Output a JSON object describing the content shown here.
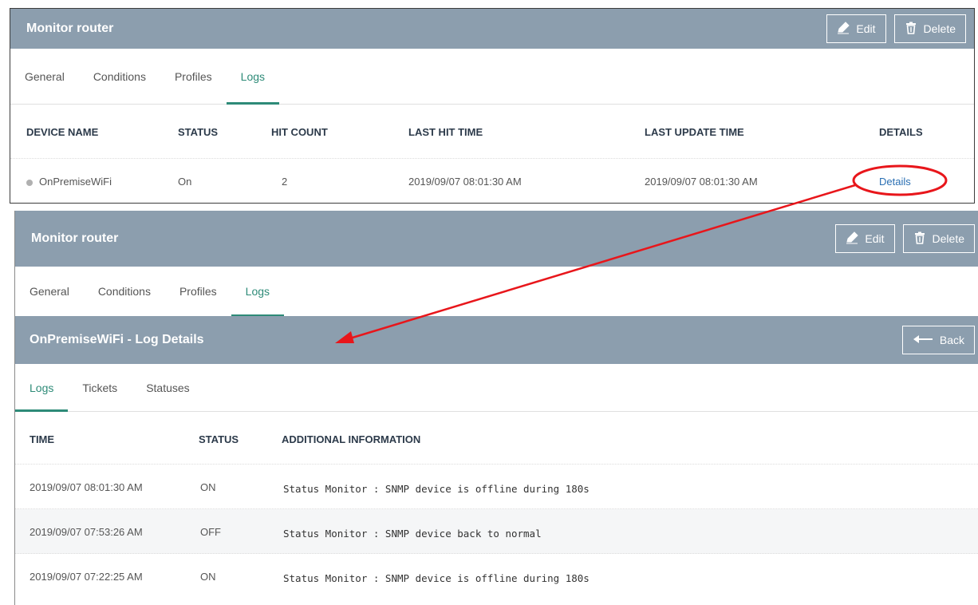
{
  "top_panel": {
    "title": "Monitor router",
    "edit_label": "Edit",
    "delete_label": "Delete",
    "tabs": [
      "General",
      "Conditions",
      "Profiles",
      "Logs"
    ],
    "active_tab": "Logs",
    "columns": [
      "DEVICE NAME",
      "STATUS",
      "HIT COUNT",
      "LAST HIT TIME",
      "LAST UPDATE TIME",
      "DETAILS"
    ],
    "row": {
      "device_name": "OnPremiseWiFi",
      "status": "On",
      "hit_count": "2",
      "last_hit_time": "2019/09/07 08:01:30 AM",
      "last_update_time": "2019/09/07 08:01:30 AM",
      "details": "Details"
    }
  },
  "bottom_panel": {
    "title": "Monitor router",
    "edit_label": "Edit",
    "delete_label": "Delete",
    "tabs": [
      "General",
      "Conditions",
      "Profiles",
      "Logs"
    ],
    "active_tab": "Logs",
    "details_title": "OnPremiseWiFi - Log Details",
    "back_label": "Back",
    "sub_tabs": [
      "Logs",
      "Tickets",
      "Statuses"
    ],
    "active_sub_tab": "Logs",
    "columns": [
      "TIME",
      "STATUS",
      "ADDITIONAL INFORMATION"
    ],
    "rows": [
      {
        "time": "2019/09/07 08:01:30 AM",
        "status": "ON",
        "info": "Status Monitor : SNMP device is offline during 180s"
      },
      {
        "time": "2019/09/07 07:53:26 AM",
        "status": "OFF",
        "info": "Status Monitor : SNMP device back to normal"
      },
      {
        "time": "2019/09/07 07:22:25 AM",
        "status": "ON",
        "info": "Status Monitor : SNMP device is offline during 180s"
      }
    ]
  },
  "colors": {
    "header_bg": "#8c9eae",
    "accent": "#2e8b78",
    "link": "#2a6fb3",
    "annotation": "#e8161b"
  }
}
